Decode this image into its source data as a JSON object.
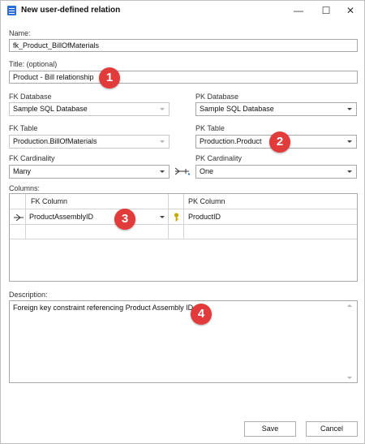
{
  "window": {
    "title": "New user-defined relation",
    "minimize_glyph": "—",
    "maximize_glyph": "☐",
    "close_glyph": "✕"
  },
  "form": {
    "name_label": "Name:",
    "name_value": "fk_Product_BillOfMaterials",
    "title_label": "Title: (optional)",
    "title_value": "Product - Bill relationship",
    "fk_database_label": "FK Database",
    "fk_database_value": "Sample SQL Database",
    "pk_database_label": "PK Database",
    "pk_database_value": "Sample SQL Database",
    "fk_table_label": "FK Table",
    "fk_table_value": "Production.BillOfMaterials",
    "pk_table_label": "PK Table",
    "pk_table_value": "Production.Product",
    "fk_cardinality_label": "FK Cardinality",
    "fk_cardinality_value": "Many",
    "pk_cardinality_label": "PK Cardinality",
    "pk_cardinality_value": "One",
    "columns_label": "Columns:",
    "description_label": "Description:",
    "description_value": "Foreign key constraint referencing Product Assembly ID."
  },
  "columns_grid": {
    "headers": [
      "FK Column",
      "PK Column"
    ],
    "rows": [
      {
        "fk_column": "ProductAssemblyID",
        "pk_column": "ProductID"
      }
    ]
  },
  "buttons": {
    "save": "Save",
    "cancel": "Cancel"
  },
  "badges": [
    "1",
    "2",
    "3",
    "4"
  ],
  "icons": {
    "app": "table-relation-icon",
    "relation": "one-to-many-link-icon",
    "key": "key-icon",
    "row_relation": "crowfoot-icon"
  },
  "colors": {
    "badge": "#e23b3b",
    "app_icon": "#2b6fd6",
    "key": "#c9a800"
  }
}
